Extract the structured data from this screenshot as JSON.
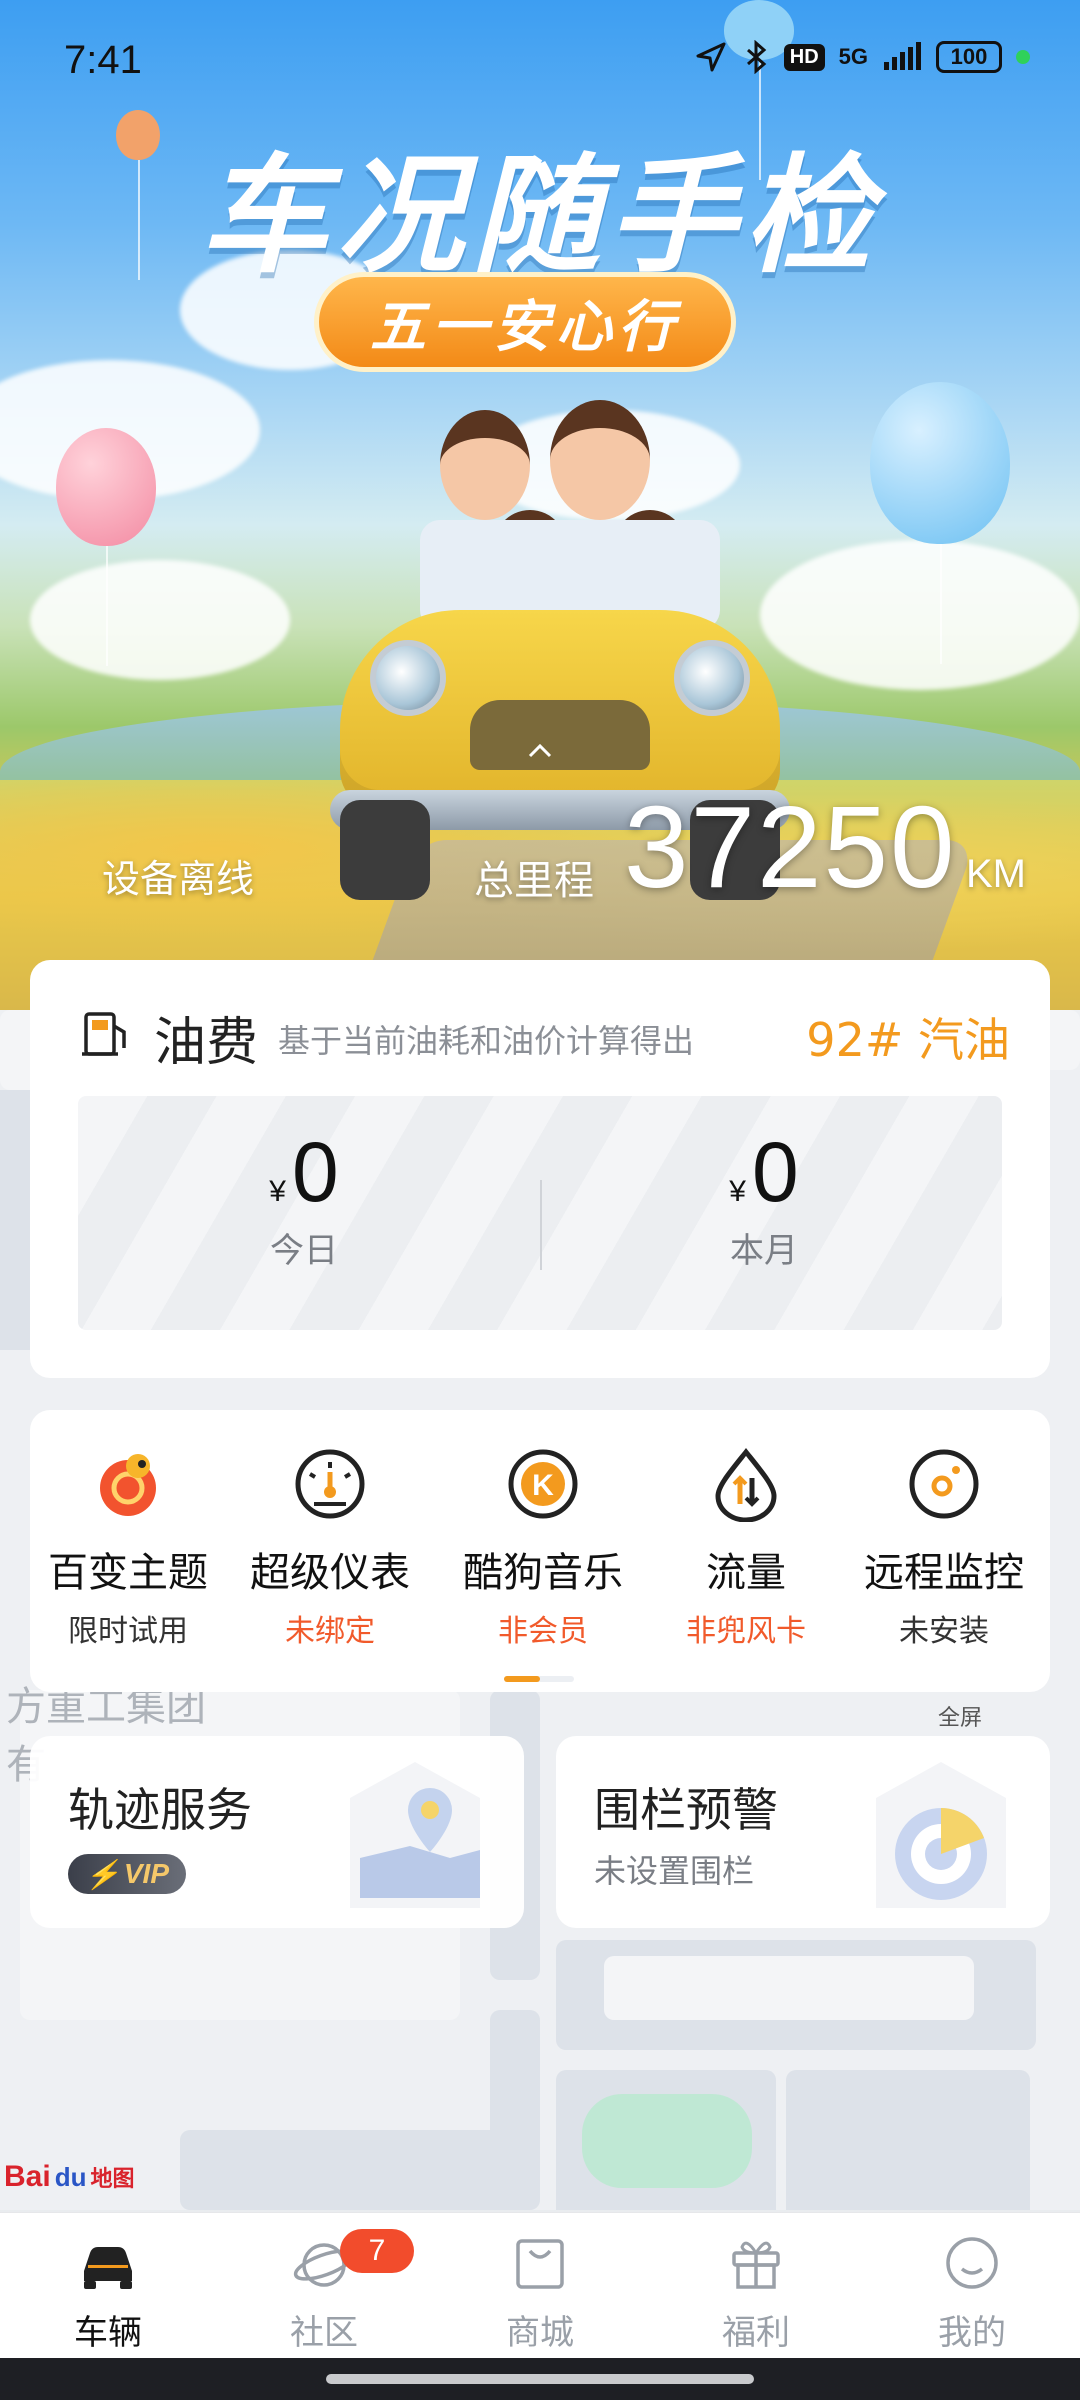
{
  "status_bar": {
    "time": "7:41",
    "hd": "HD",
    "network": "5G",
    "battery": "100"
  },
  "hero": {
    "title": "车况随手检",
    "pill": "五一安心行",
    "device_status": "设备离线",
    "mileage_label": "总里程",
    "mileage_value": "37250",
    "mileage_unit": "KM"
  },
  "fuel": {
    "title": "油费",
    "subtitle": "基于当前油耗和油价计算得出",
    "fuel_type": "92# 汽油",
    "currency": "¥",
    "today_value": "0",
    "today_label": "今日",
    "month_value": "0",
    "month_label": "本月"
  },
  "features": [
    {
      "title": "百变主题",
      "sub": "限时试用",
      "icon": "chameleon-icon",
      "sub_color": "#333333"
    },
    {
      "title": "超级仪表",
      "sub": "未绑定",
      "icon": "speedometer-icon",
      "sub_color": "#f15a2b"
    },
    {
      "title": "酷狗音乐",
      "sub": "非会员",
      "icon": "kugou-music-icon",
      "sub_color": "#f15a2b"
    },
    {
      "title": "流量",
      "sub": "非兜风卡",
      "icon": "data-traffic-icon",
      "sub_color": "#f15a2b"
    },
    {
      "title": "远程监控",
      "sub": "未安装",
      "icon": "camera-icon",
      "sub_color": "#333333"
    }
  ],
  "services": {
    "track_title": "轨迹服务",
    "track_badge": "VIP",
    "fence_title": "围栏预警",
    "fence_sub": "未设置围栏"
  },
  "map": {
    "label_top": "方重工集团",
    "label_side": "有",
    "fullscreen": "全屏",
    "brand_bai": "Bai",
    "brand_du": "du",
    "brand_map": "地图"
  },
  "bottom_nav": [
    {
      "label": "车辆",
      "icon": "car-icon",
      "active": true
    },
    {
      "label": "社区",
      "icon": "planet-icon",
      "badge": "7"
    },
    {
      "label": "商城",
      "icon": "shopping-bag-icon"
    },
    {
      "label": "福利",
      "icon": "gift-icon"
    },
    {
      "label": "我的",
      "icon": "profile-icon"
    }
  ],
  "colors": {
    "accent_orange": "#f39a1e",
    "warning_red": "#f15a2b",
    "badge_red": "#f24c2c"
  }
}
